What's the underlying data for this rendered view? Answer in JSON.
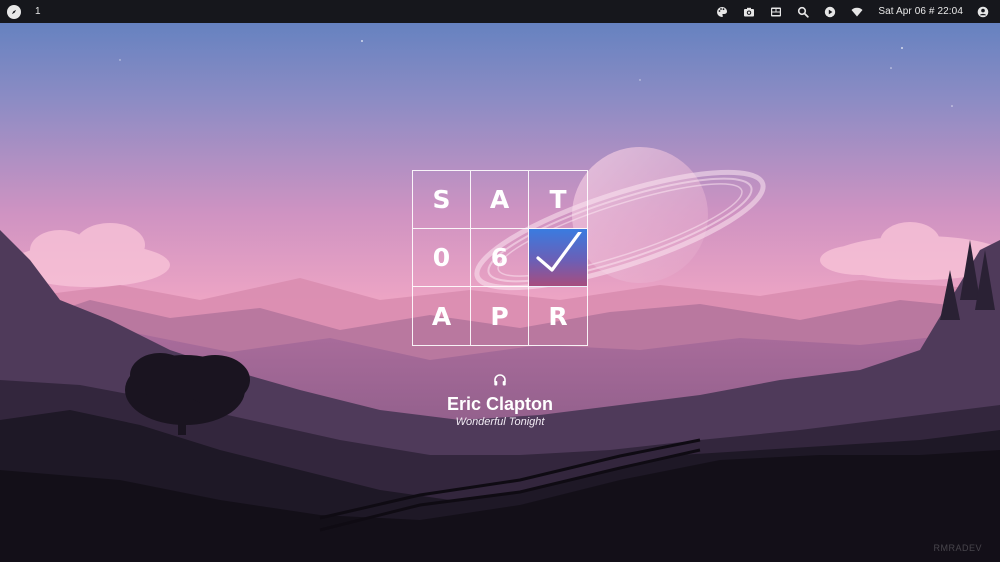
{
  "topbar": {
    "launcher_icon": "compass-icon",
    "workspace": "1",
    "tray_icons": [
      "palette-icon",
      "camera-icon",
      "window-switcher-icon",
      "search-icon",
      "play-icon",
      "wifi-icon",
      "user-icon"
    ],
    "clock": "Sat Apr 06 # 22:04"
  },
  "date_widget": {
    "cells": [
      "S",
      "A",
      "T",
      "0",
      "6",
      "",
      "A",
      "P",
      "R"
    ],
    "highlight_icon": "check-icon",
    "highlight_color": "#3a7be0"
  },
  "now_playing": {
    "icon": "headphones-icon",
    "artist": "Eric Clapton",
    "title": "Wonderful Tonight"
  },
  "watermark": "RMRADEV"
}
